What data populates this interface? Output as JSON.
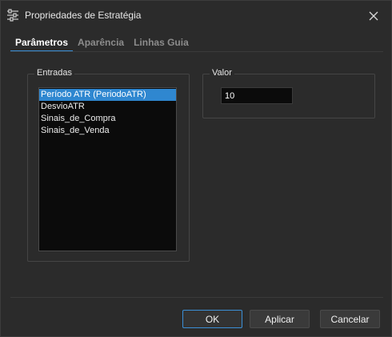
{
  "window": {
    "title": "Propriedades de Estratégia",
    "icon": "sliders-icon",
    "close_icon": "close-icon"
  },
  "tabs": [
    {
      "label": "Parâmetros",
      "active": true
    },
    {
      "label": "Aparência",
      "active": false
    },
    {
      "label": "Linhas Guia",
      "active": false
    }
  ],
  "entradas": {
    "title": "Entradas",
    "items": [
      {
        "label": "Período ATR (PeriodoATR)",
        "selected": true
      },
      {
        "label": "DesvioATR",
        "selected": false
      },
      {
        "label": "Sinais_de_Compra",
        "selected": false
      },
      {
        "label": "Sinais_de_Venda",
        "selected": false
      }
    ]
  },
  "valor": {
    "title": "Valor",
    "value": "10"
  },
  "buttons": {
    "ok": "OK",
    "apply": "Aplicar",
    "cancel": "Cancelar"
  },
  "colors": {
    "accent": "#2f87d0",
    "background": "#2b2b2b",
    "field": "#0b0b0b"
  }
}
